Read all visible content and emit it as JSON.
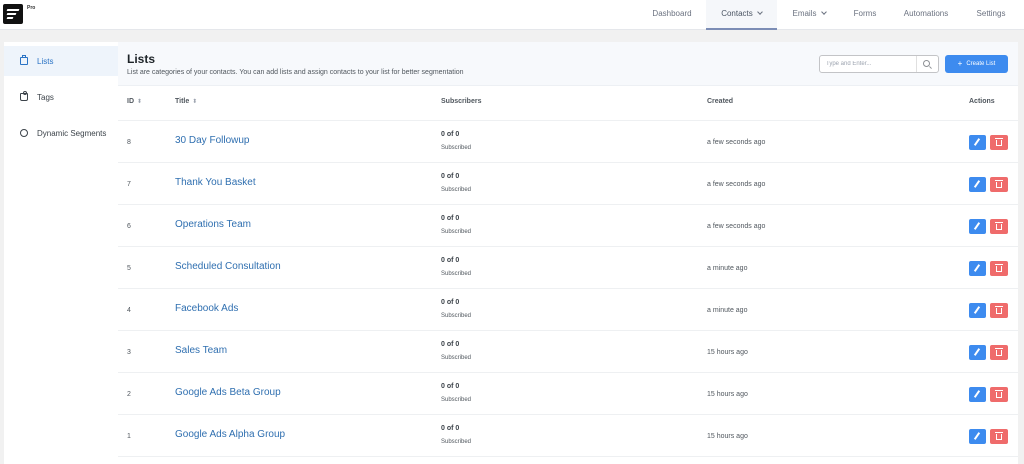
{
  "brand": {
    "badge": "Pro"
  },
  "nav": {
    "items": [
      {
        "label": "Dashboard",
        "dropdown": false,
        "active": false
      },
      {
        "label": "Contacts",
        "dropdown": true,
        "active": true
      },
      {
        "label": "Emails",
        "dropdown": true,
        "active": false
      },
      {
        "label": "Forms",
        "dropdown": false,
        "active": false
      },
      {
        "label": "Automations",
        "dropdown": false,
        "active": false
      },
      {
        "label": "Settings",
        "dropdown": false,
        "active": false
      }
    ]
  },
  "sidebar": {
    "items": [
      {
        "label": "Lists",
        "icon": "lists-icon",
        "active": true
      },
      {
        "label": "Tags",
        "icon": "tag-icon",
        "active": false
      },
      {
        "label": "Dynamic Segments",
        "icon": "segment-icon",
        "active": false
      }
    ]
  },
  "main": {
    "title": "Lists",
    "subtitle": "List are categories of your contacts. You can add lists and assign contacts to your list for better segmentation",
    "search": {
      "placeholder": "Type and Enter...",
      "value": ""
    },
    "create_label": "Create List",
    "create_icon": "+"
  },
  "table": {
    "columns": {
      "id": "ID",
      "title": "Title",
      "subscribers": "Subscribers",
      "created": "Created",
      "actions": "Actions"
    },
    "sort_icon": "⬍",
    "rows": [
      {
        "id": "8",
        "title": "30 Day Followup",
        "count": "0 of 0",
        "status": "Subscribed",
        "created": "a few seconds ago"
      },
      {
        "id": "7",
        "title": "Thank You Basket",
        "count": "0 of 0",
        "status": "Subscribed",
        "created": "a few seconds ago"
      },
      {
        "id": "6",
        "title": "Operations Team",
        "count": "0 of 0",
        "status": "Subscribed",
        "created": "a few seconds ago"
      },
      {
        "id": "5",
        "title": "Scheduled Consultation",
        "count": "0 of 0",
        "status": "Subscribed",
        "created": "a minute ago"
      },
      {
        "id": "4",
        "title": "Facebook Ads",
        "count": "0 of 0",
        "status": "Subscribed",
        "created": "a minute ago"
      },
      {
        "id": "3",
        "title": "Sales Team",
        "count": "0 of 0",
        "status": "Subscribed",
        "created": "15 hours ago"
      },
      {
        "id": "2",
        "title": "Google Ads Beta Group",
        "count": "0 of 0",
        "status": "Subscribed",
        "created": "15 hours ago"
      },
      {
        "id": "1",
        "title": "Google Ads Alpha Group",
        "count": "0 of 0",
        "status": "Subscribed",
        "created": "15 hours ago"
      }
    ]
  },
  "colors": {
    "accent": "#3d8bef",
    "danger": "#ef6b6b",
    "link": "#2f6fb0"
  }
}
